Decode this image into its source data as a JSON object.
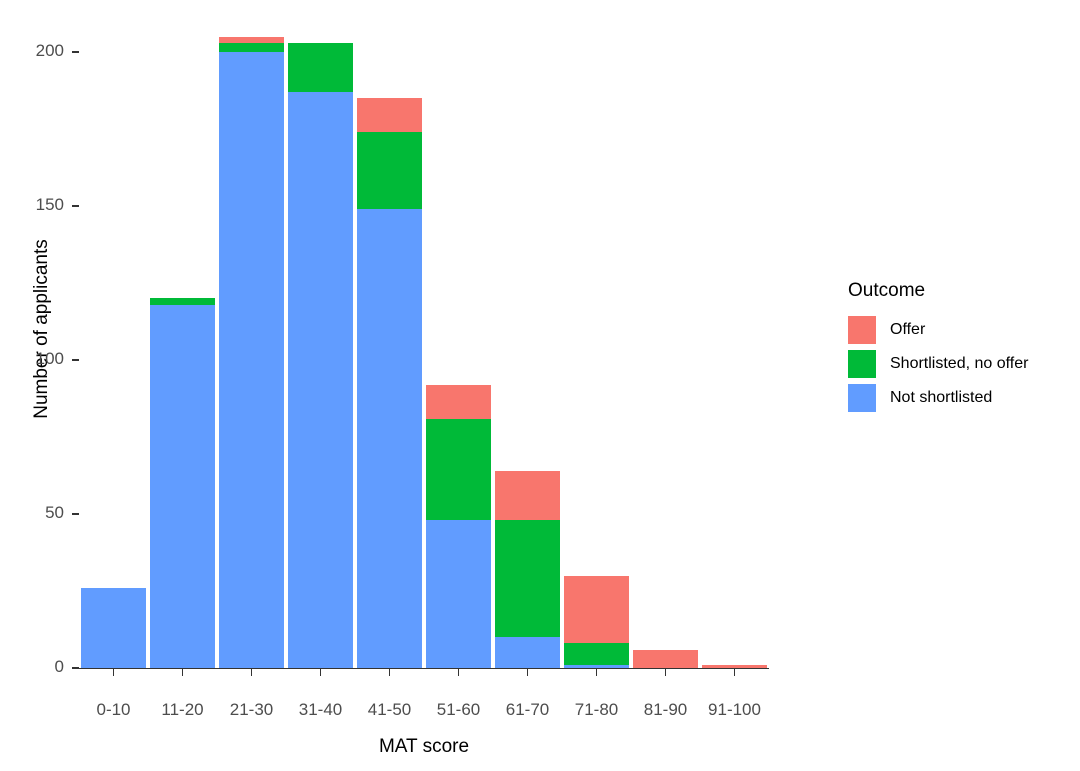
{
  "chart_data": {
    "type": "bar",
    "stacked": true,
    "title": "",
    "xlabel": "MAT score",
    "ylabel": "Number of applicants",
    "categories": [
      "0-10",
      "11-20",
      "21-30",
      "31-40",
      "41-50",
      "51-60",
      "61-70",
      "71-80",
      "81-90",
      "91-100"
    ],
    "series": [
      {
        "name": "Not shortlisted",
        "color": "#619CFF",
        "values": [
          26,
          118,
          200,
          187,
          149,
          48,
          10,
          1,
          0,
          0
        ]
      },
      {
        "name": "Shortlisted, no offer",
        "color": "#00BA38",
        "values": [
          0,
          2,
          3,
          16,
          25,
          33,
          38,
          7,
          0,
          0
        ]
      },
      {
        "name": "Offer",
        "color": "#F8766D",
        "values": [
          0,
          0,
          2,
          0,
          11,
          11,
          16,
          22,
          6,
          1
        ]
      }
    ],
    "stack_order_bottom_to_top": [
      "Not shortlisted",
      "Shortlisted, no offer",
      "Offer"
    ],
    "totals": [
      26,
      120,
      205,
      203,
      185,
      92,
      64,
      30,
      6,
      1
    ],
    "ylim": [
      0,
      212
    ],
    "yticks": [
      0,
      50,
      100,
      150,
      200
    ],
    "ytick_labels": [
      "0",
      "50",
      "100",
      "150",
      "200"
    ],
    "grid": false,
    "legend_position": "right",
    "legend_title": "Outcome"
  },
  "legend": {
    "title": "Outcome",
    "items": [
      {
        "label": "Offer",
        "color": "#F8766D"
      },
      {
        "label": "Shortlisted, no offer",
        "color": "#00BA38"
      },
      {
        "label": "Not shortlisted",
        "color": "#619CFF"
      }
    ]
  },
  "axes": {
    "x_title": "MAT score",
    "y_title": "Number of applicants"
  }
}
